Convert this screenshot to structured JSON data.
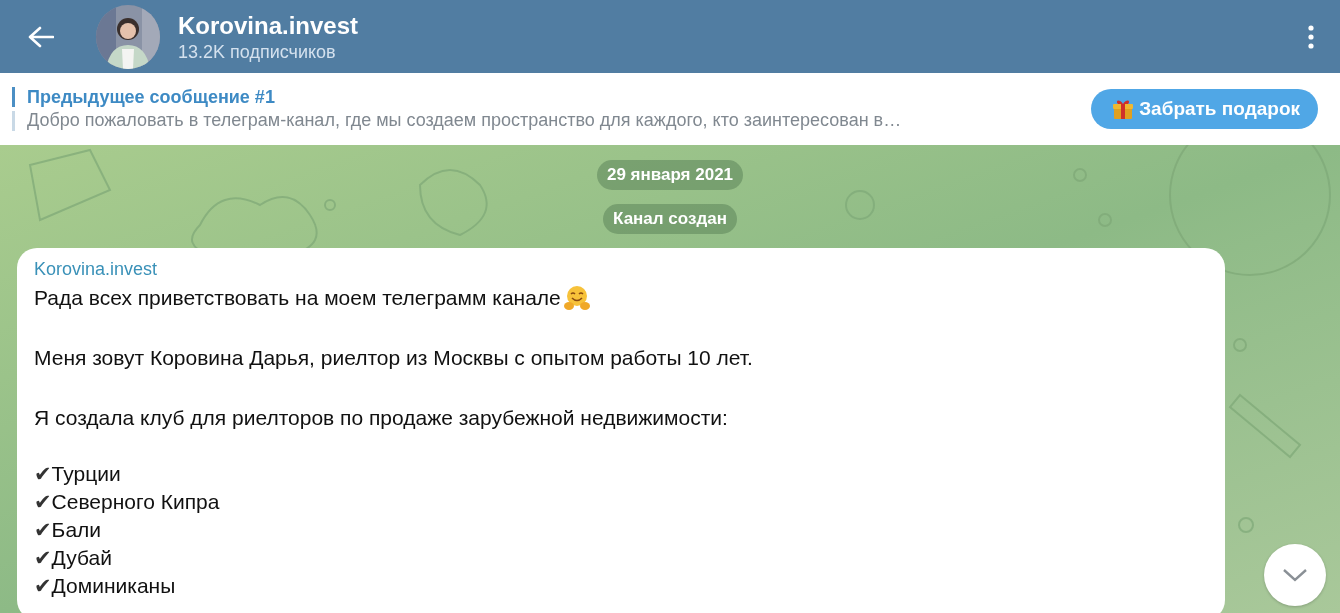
{
  "header": {
    "title": "Korovina.invest",
    "subtitle": "13.2K подписчиков"
  },
  "pinned": {
    "title": "Предыдущее сообщение #1",
    "preview": "Добро пожаловать в телеграм-канал, где мы создаем пространство для каждого, кто заинтересован в…",
    "button": "Забрать подарок"
  },
  "service_messages": [
    "29 января 2021",
    "Канал создан"
  ],
  "message": {
    "author": "Korovina.invest",
    "blocks": [
      {
        "kind": "greeting",
        "text": "Рада всех приветствовать на моем телеграмм канале"
      },
      {
        "kind": "paragraph",
        "text": "Меня зовут Коровина Дарья, риелтор из Москвы с опытом работы 10 лет."
      },
      {
        "kind": "paragraph",
        "text": "Я создала клуб для риелторов по продаже зарубежной недвижимости:"
      },
      {
        "kind": "checklist",
        "items": [
          {
            "mark": "✔",
            "text": "Турции"
          },
          {
            "mark": "✔",
            "text": "Северного Кипра"
          },
          {
            "mark": "✔",
            "text": "Бали"
          },
          {
            "mark": "✔",
            "text": "Дубай"
          },
          {
            "mark": "✔",
            "text": "Доминиканы"
          }
        ]
      }
    ]
  }
}
